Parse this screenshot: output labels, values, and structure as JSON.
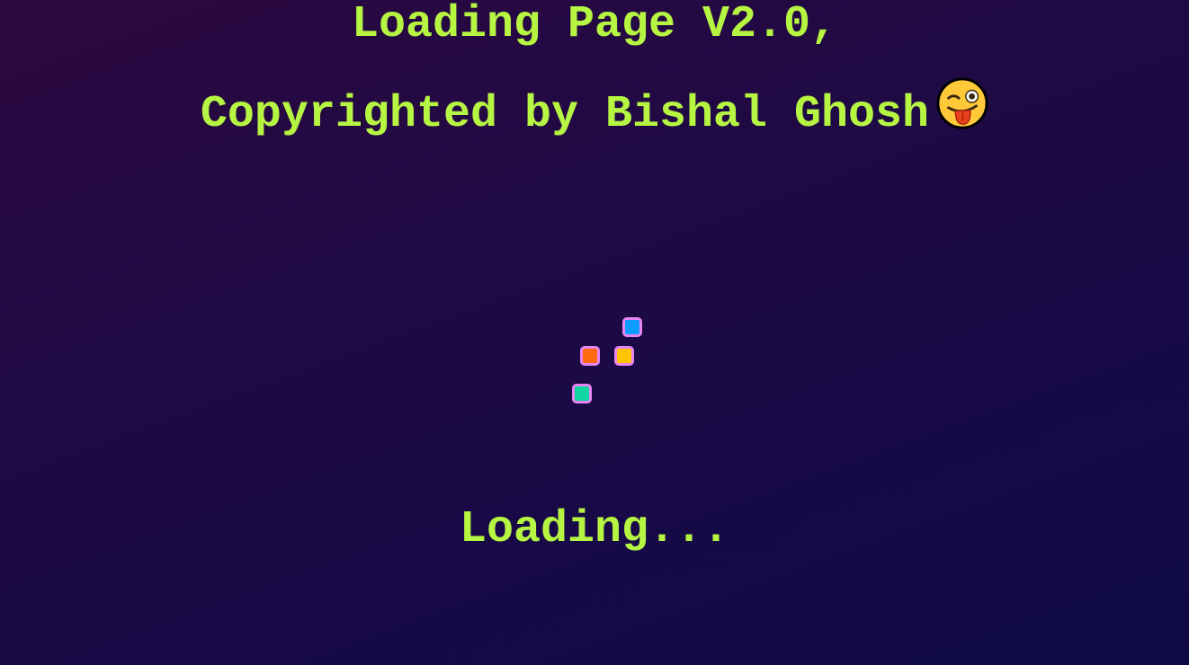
{
  "header": {
    "line1": "Loading Page V2.0,",
    "line2": "Copyrighted by Bishal Ghosh",
    "emoji_icon": "winking-face-with-tongue-icon"
  },
  "loader": {
    "dots": [
      {
        "name": "blue",
        "color": "#0a9dff"
      },
      {
        "name": "orange",
        "color": "#ff6a10"
      },
      {
        "name": "yellow",
        "color": "#ffc400"
      },
      {
        "name": "teal",
        "color": "#10d6a3"
      }
    ],
    "dot_border_color": "#e786f0"
  },
  "status": {
    "text": "Loading..."
  },
  "colors": {
    "text": "#b6f542",
    "background_start": "#2c083f",
    "background_end": "#0f0b47"
  }
}
